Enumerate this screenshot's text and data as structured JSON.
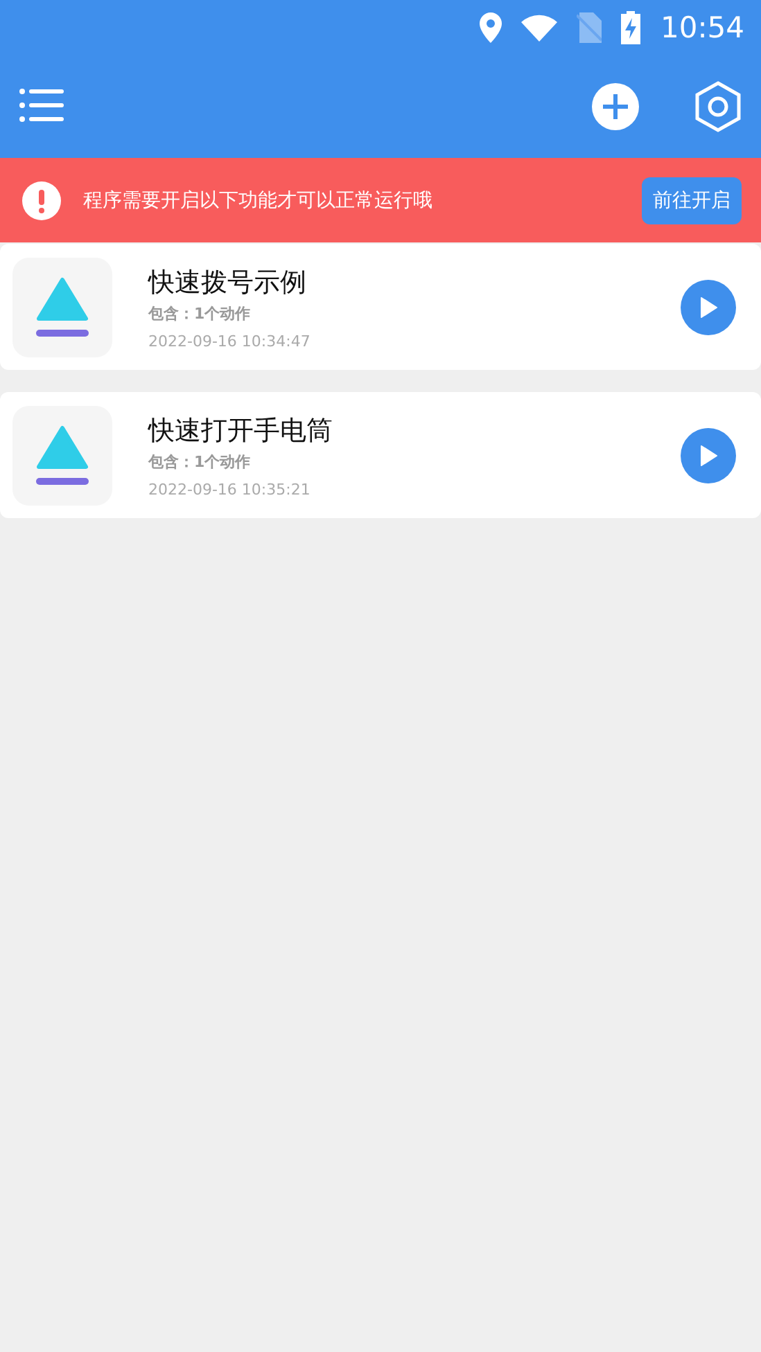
{
  "status_bar": {
    "time": "10:54"
  },
  "banner": {
    "message": "程序需要开启以下功能才可以正常运行哦",
    "button": "前往开启"
  },
  "tasks": [
    {
      "title": "快速拨号示例",
      "summary": "包含：1个动作",
      "date": "2022-09-16 10:34:47"
    },
    {
      "title": "快速打开手电筒",
      "summary": "包含：1个动作",
      "date": "2022-09-16 10:35:21"
    }
  ]
}
